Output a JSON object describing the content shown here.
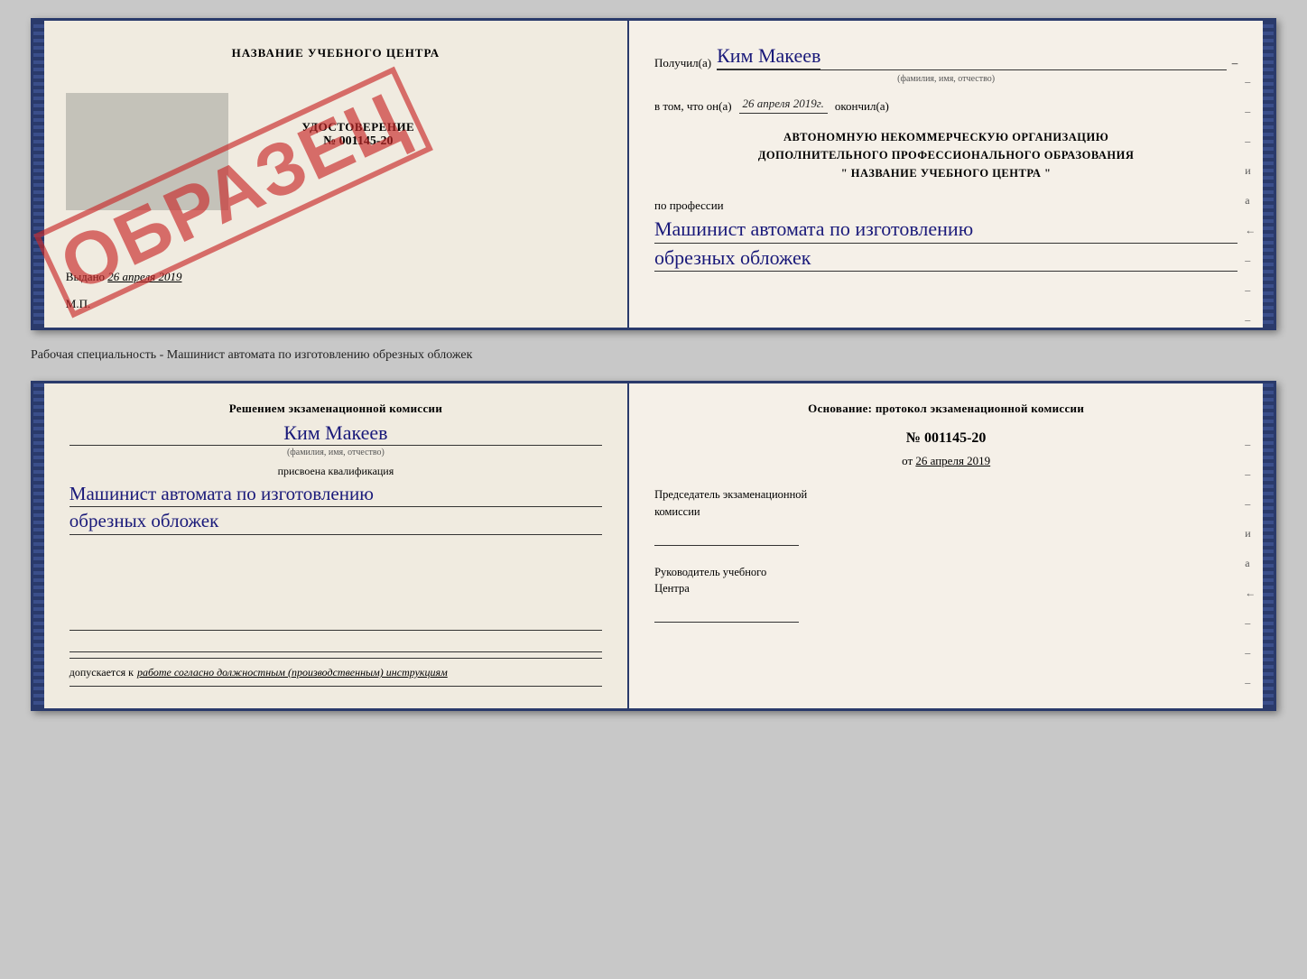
{
  "top_doc": {
    "left": {
      "title": "НАЗВАНИЕ УЧЕБНОГО ЦЕНТРА",
      "certificate_label": "УДОСТОВЕРЕНИЕ",
      "certificate_num": "№ 001145-20",
      "stamp": "ОБРАЗЕЦ",
      "vydano_label": "Выдано",
      "vydano_date": "26 апреля 2019",
      "mp": "М.П."
    },
    "right": {
      "poluchil_label": "Получил(а)",
      "recipient_name": "Ким Макеев",
      "fio_hint": "(фамилия, имя, отчество)",
      "vtom_label": "в том, что он(а)",
      "vtom_date": "26 апреля 2019г.",
      "okonchil_label": "окончил(а)",
      "org_line1": "АВТОНОМНУЮ НЕКОММЕРЧЕСКУЮ ОРГАНИЗАЦИЮ",
      "org_line2": "ДОПОЛНИТЕЛЬНОГО ПРОФЕССИОНАЛЬНОГО ОБРАЗОВАНИЯ",
      "org_name": "\" НАЗВАНИЕ УЧЕБНОГО ЦЕНТРА \"",
      "po_professii_label": "по профессии",
      "profession_line1": "Машинист автомата по изготовлению",
      "profession_line2": "обрезных обложек",
      "dash1": "–",
      "dash2": "–",
      "dash3": "–",
      "dash4": "и",
      "dash5": "а",
      "dash6": "←",
      "dash7": "–",
      "dash8": "–",
      "dash9": "–"
    }
  },
  "middle": {
    "text": "Рабочая специальность - Машинист автомата по изготовлению обрезных обложек"
  },
  "bottom_doc": {
    "left": {
      "resheniem_label": "Решением экзаменационной комиссии",
      "name_hw": "Ким Макеев",
      "fio_hint": "(фамилия, имя, отчество)",
      "prisvoena_label": "присвоена квалификация",
      "kvalif_line1": "Машинист автомата по изготовлению",
      "kvalif_line2": "обрезных обложек",
      "dopuskaetsya_prefix": "допускается к",
      "dopuskaetsya_text": "работе согласно должностным (производственным) инструкциям"
    },
    "right": {
      "osnovanie_label": "Основание: протокол экзаменационной комиссии",
      "protocol_num": "№ 001145-20",
      "ot_prefix": "от",
      "ot_date": "26 апреля 2019",
      "chairman_line1": "Председатель экзаменационной",
      "chairman_line2": "комиссии",
      "rukovoditel_line1": "Руководитель учебного",
      "rukovoditel_line2": "Центра",
      "dash1": "–",
      "dash2": "–",
      "dash3": "–",
      "dash4": "и",
      "dash5": "а",
      "dash6": "←",
      "dash7": "–",
      "dash8": "–",
      "dash9": "–"
    }
  }
}
